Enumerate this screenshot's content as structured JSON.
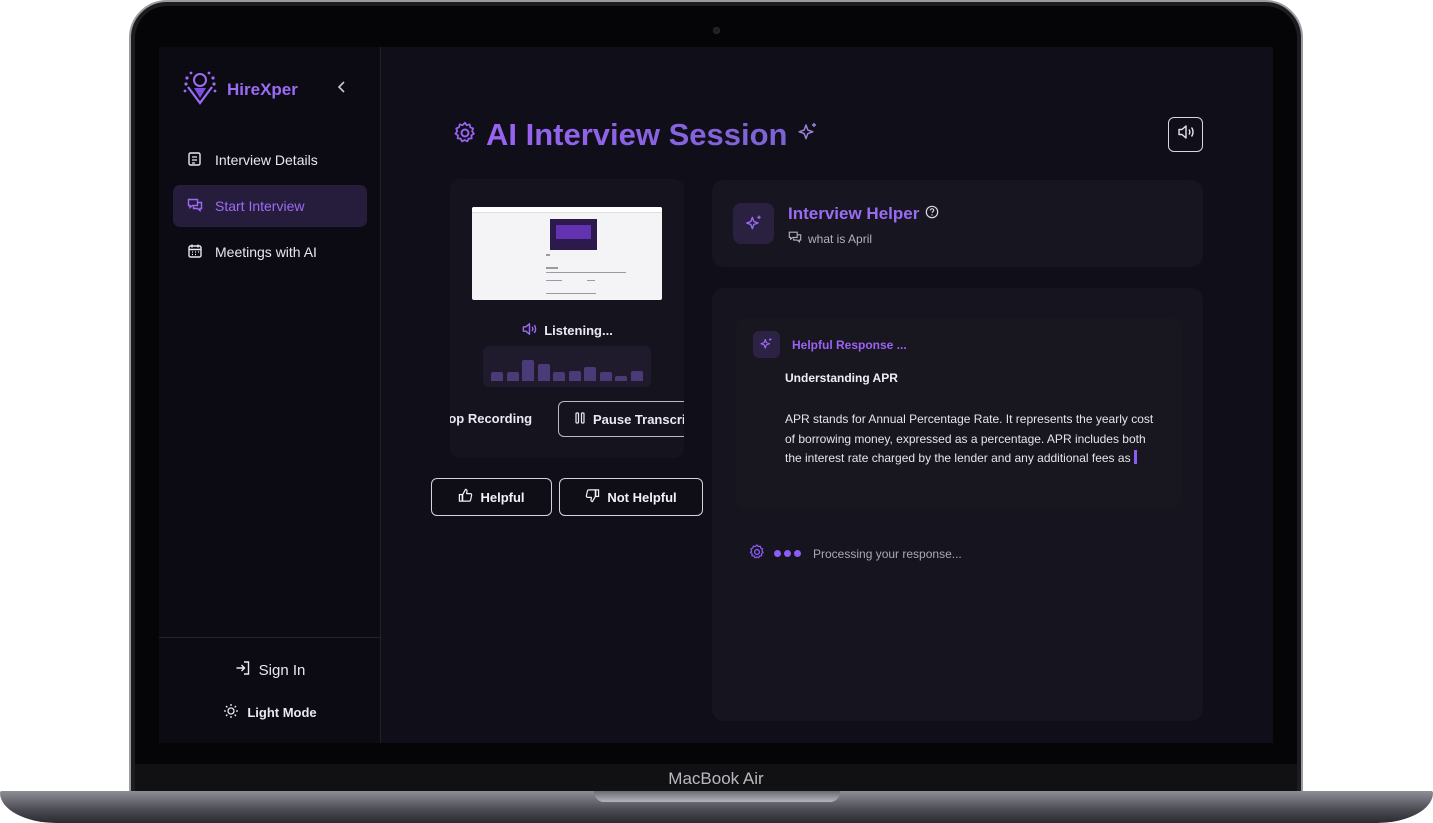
{
  "device": {
    "label": "MacBook Air"
  },
  "brand": {
    "name": "HireXper"
  },
  "sidebar": {
    "items": [
      {
        "label": "Interview Details",
        "icon": "scroll-icon"
      },
      {
        "label": "Start Interview",
        "icon": "chat-icon",
        "active": true
      },
      {
        "label": "Meetings with AI",
        "icon": "calendar-icon"
      }
    ],
    "sign_in": "Sign In",
    "theme_toggle": "Light Mode"
  },
  "main": {
    "title": "AI Interview Session",
    "video": {
      "status": "Listening...",
      "stop_label": "top Recording",
      "pause_label": "Pause Transcrip",
      "waveform_levels": [
        0.35,
        0.35,
        0.8,
        0.65,
        0.35,
        0.4,
        0.55,
        0.35,
        0.2,
        0.4
      ]
    },
    "feedback": {
      "helpful": "Helpful",
      "not_helpful": "Not Helpful"
    },
    "helper": {
      "title": "Interview Helper",
      "question": "what is April"
    },
    "response": {
      "label": "Helpful Response ...",
      "heading": "Understanding APR",
      "body": "APR stands for Annual Percentage Rate. It represents the yearly cost of borrowing money, expressed as a percentage. APR includes both the interest rate charged by the lender and any additional fees as",
      "processing": "Processing your response..."
    }
  },
  "colors": {
    "accent": "#9b6cf5",
    "background": "#0f0d17",
    "sidebar": "#0c0b13",
    "active_nav": "#261d3d"
  }
}
